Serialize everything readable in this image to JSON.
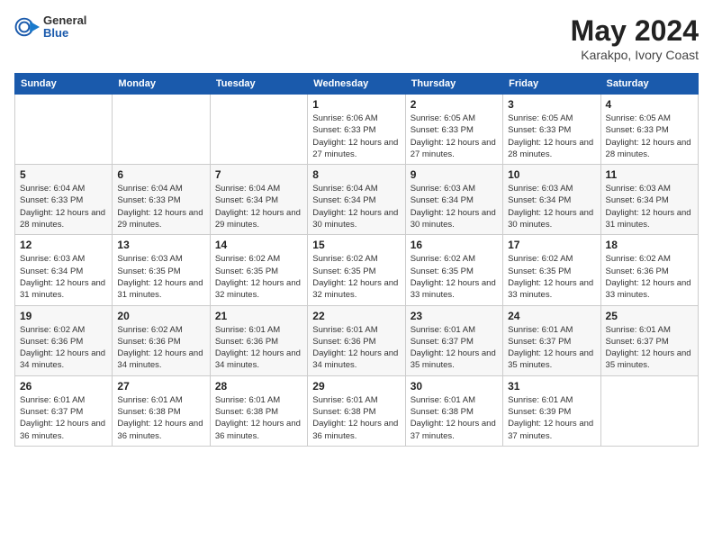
{
  "header": {
    "logo": {
      "general": "General",
      "blue": "Blue"
    },
    "title": "May 2024",
    "location": "Karakpo, Ivory Coast"
  },
  "weekdays": [
    "Sunday",
    "Monday",
    "Tuesday",
    "Wednesday",
    "Thursday",
    "Friday",
    "Saturday"
  ],
  "weeks": [
    [
      {
        "day": null,
        "info": null
      },
      {
        "day": null,
        "info": null
      },
      {
        "day": null,
        "info": null
      },
      {
        "day": "1",
        "sunrise": "6:06 AM",
        "sunset": "6:33 PM",
        "daylight": "12 hours and 27 minutes."
      },
      {
        "day": "2",
        "sunrise": "6:05 AM",
        "sunset": "6:33 PM",
        "daylight": "12 hours and 27 minutes."
      },
      {
        "day": "3",
        "sunrise": "6:05 AM",
        "sunset": "6:33 PM",
        "daylight": "12 hours and 28 minutes."
      },
      {
        "day": "4",
        "sunrise": "6:05 AM",
        "sunset": "6:33 PM",
        "daylight": "12 hours and 28 minutes."
      }
    ],
    [
      {
        "day": "5",
        "sunrise": "6:04 AM",
        "sunset": "6:33 PM",
        "daylight": "12 hours and 28 minutes."
      },
      {
        "day": "6",
        "sunrise": "6:04 AM",
        "sunset": "6:33 PM",
        "daylight": "12 hours and 29 minutes."
      },
      {
        "day": "7",
        "sunrise": "6:04 AM",
        "sunset": "6:34 PM",
        "daylight": "12 hours and 29 minutes."
      },
      {
        "day": "8",
        "sunrise": "6:04 AM",
        "sunset": "6:34 PM",
        "daylight": "12 hours and 30 minutes."
      },
      {
        "day": "9",
        "sunrise": "6:03 AM",
        "sunset": "6:34 PM",
        "daylight": "12 hours and 30 minutes."
      },
      {
        "day": "10",
        "sunrise": "6:03 AM",
        "sunset": "6:34 PM",
        "daylight": "12 hours and 30 minutes."
      },
      {
        "day": "11",
        "sunrise": "6:03 AM",
        "sunset": "6:34 PM",
        "daylight": "12 hours and 31 minutes."
      }
    ],
    [
      {
        "day": "12",
        "sunrise": "6:03 AM",
        "sunset": "6:34 PM",
        "daylight": "12 hours and 31 minutes."
      },
      {
        "day": "13",
        "sunrise": "6:03 AM",
        "sunset": "6:35 PM",
        "daylight": "12 hours and 31 minutes."
      },
      {
        "day": "14",
        "sunrise": "6:02 AM",
        "sunset": "6:35 PM",
        "daylight": "12 hours and 32 minutes."
      },
      {
        "day": "15",
        "sunrise": "6:02 AM",
        "sunset": "6:35 PM",
        "daylight": "12 hours and 32 minutes."
      },
      {
        "day": "16",
        "sunrise": "6:02 AM",
        "sunset": "6:35 PM",
        "daylight": "12 hours and 33 minutes."
      },
      {
        "day": "17",
        "sunrise": "6:02 AM",
        "sunset": "6:35 PM",
        "daylight": "12 hours and 33 minutes."
      },
      {
        "day": "18",
        "sunrise": "6:02 AM",
        "sunset": "6:36 PM",
        "daylight": "12 hours and 33 minutes."
      }
    ],
    [
      {
        "day": "19",
        "sunrise": "6:02 AM",
        "sunset": "6:36 PM",
        "daylight": "12 hours and 34 minutes."
      },
      {
        "day": "20",
        "sunrise": "6:02 AM",
        "sunset": "6:36 PM",
        "daylight": "12 hours and 34 minutes."
      },
      {
        "day": "21",
        "sunrise": "6:01 AM",
        "sunset": "6:36 PM",
        "daylight": "12 hours and 34 minutes."
      },
      {
        "day": "22",
        "sunrise": "6:01 AM",
        "sunset": "6:36 PM",
        "daylight": "12 hours and 34 minutes."
      },
      {
        "day": "23",
        "sunrise": "6:01 AM",
        "sunset": "6:37 PM",
        "daylight": "12 hours and 35 minutes."
      },
      {
        "day": "24",
        "sunrise": "6:01 AM",
        "sunset": "6:37 PM",
        "daylight": "12 hours and 35 minutes."
      },
      {
        "day": "25",
        "sunrise": "6:01 AM",
        "sunset": "6:37 PM",
        "daylight": "12 hours and 35 minutes."
      }
    ],
    [
      {
        "day": "26",
        "sunrise": "6:01 AM",
        "sunset": "6:37 PM",
        "daylight": "12 hours and 36 minutes."
      },
      {
        "day": "27",
        "sunrise": "6:01 AM",
        "sunset": "6:38 PM",
        "daylight": "12 hours and 36 minutes."
      },
      {
        "day": "28",
        "sunrise": "6:01 AM",
        "sunset": "6:38 PM",
        "daylight": "12 hours and 36 minutes."
      },
      {
        "day": "29",
        "sunrise": "6:01 AM",
        "sunset": "6:38 PM",
        "daylight": "12 hours and 36 minutes."
      },
      {
        "day": "30",
        "sunrise": "6:01 AM",
        "sunset": "6:38 PM",
        "daylight": "12 hours and 37 minutes."
      },
      {
        "day": "31",
        "sunrise": "6:01 AM",
        "sunset": "6:39 PM",
        "daylight": "12 hours and 37 minutes."
      },
      {
        "day": null,
        "info": null
      }
    ]
  ]
}
